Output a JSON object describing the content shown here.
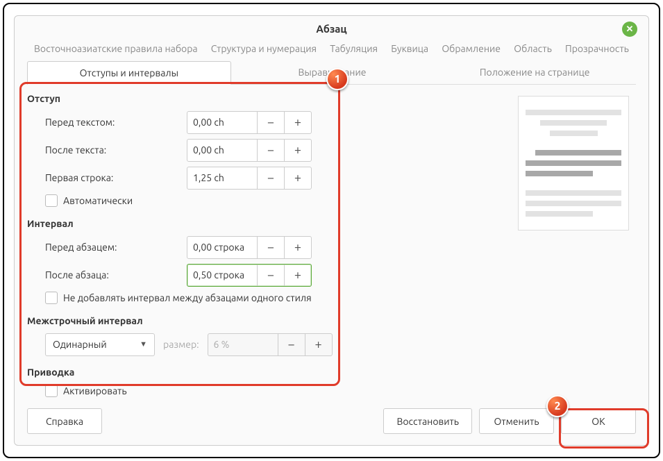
{
  "title": "Абзац",
  "tabs_top": [
    "Восточноазиатские правила набора",
    "Структура и нумерация",
    "Табуляция",
    "Буквица",
    "Обрамление",
    "Область",
    "Прозрачность"
  ],
  "tabs_bottom": [
    {
      "label": "Отступы и интервалы",
      "active": true
    },
    {
      "label": "Выравнивание",
      "active": false
    },
    {
      "label": "Положение на странице",
      "active": false
    }
  ],
  "indent": {
    "section": "Отступ",
    "before_label": "Перед текстом:",
    "before_value": "0,00 ch",
    "after_label": "После текста:",
    "after_value": "0,00 ch",
    "first_label": "Первая строка:",
    "first_value": "1,25 ch",
    "auto_label": "Автоматически"
  },
  "spacing": {
    "section": "Интервал",
    "before_label": "Перед абзацем:",
    "before_value": "0,00 строка",
    "after_label": "После абзаца:",
    "after_value": "0,50 строка",
    "nosame_label": "Не добавлять интервал между абзацами одного стиля"
  },
  "linespacing": {
    "section": "Межстрочный интервал",
    "selected": "Одинарный",
    "size_label": "размер:",
    "size_value": "6 %"
  },
  "register": {
    "section": "Приводка",
    "activate_label": "Активировать"
  },
  "buttons": {
    "help": "Справка",
    "restore": "Восстановить",
    "cancel": "Отменить",
    "ok": "ОК"
  },
  "glyphs": {
    "minus": "−",
    "plus": "+",
    "close": "✕",
    "caret": "▼"
  },
  "annotations": {
    "b1": "1",
    "b2": "2"
  }
}
